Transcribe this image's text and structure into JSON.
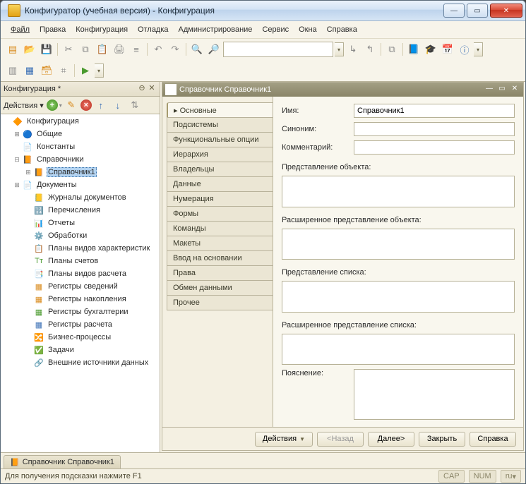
{
  "window": {
    "title": "Конфигуратор (учебная версия) - Конфигурация"
  },
  "menu": [
    "Файл",
    "Правка",
    "Конфигурация",
    "Отладка",
    "Администрирование",
    "Сервис",
    "Окна",
    "Справка"
  ],
  "side": {
    "title": "Конфигурация *",
    "actions_label": "Действия"
  },
  "tree": [
    {
      "d": 0,
      "tw": "",
      "ic": "🔶",
      "lbl": "Конфигурация"
    },
    {
      "d": 1,
      "tw": "⊞",
      "ic": "🔵",
      "lbl": "Общие"
    },
    {
      "d": 1,
      "tw": "",
      "ic": "📄",
      "lbl": "Константы"
    },
    {
      "d": 1,
      "tw": "⊟",
      "ic": "📙",
      "lbl": "Справочники"
    },
    {
      "d": 2,
      "tw": "⊞",
      "ic": "📙",
      "lbl": "Справочник1",
      "sel": true
    },
    {
      "d": 1,
      "tw": "⊞",
      "ic": "📄",
      "lbl": "Документы"
    },
    {
      "d": 2,
      "tw": "",
      "ic": "📒",
      "lbl": "Журналы документов"
    },
    {
      "d": 2,
      "tw": "",
      "ic": "🔢",
      "lbl": "Перечисления"
    },
    {
      "d": 2,
      "tw": "",
      "ic": "📊",
      "lbl": "Отчеты"
    },
    {
      "d": 2,
      "tw": "",
      "ic": "⚙️",
      "lbl": "Обработки"
    },
    {
      "d": 2,
      "tw": "",
      "ic": "📋",
      "lbl": "Планы видов характеристик"
    },
    {
      "d": 2,
      "tw": "",
      "ic": "Тт",
      "lbl": "Планы счетов",
      "cls": "c-green"
    },
    {
      "d": 2,
      "tw": "",
      "ic": "📑",
      "lbl": "Планы видов расчета"
    },
    {
      "d": 2,
      "tw": "",
      "ic": "▦",
      "lbl": "Регистры сведений",
      "cls": "c-orange"
    },
    {
      "d": 2,
      "tw": "",
      "ic": "▦",
      "lbl": "Регистры накопления",
      "cls": "c-orange"
    },
    {
      "d": 2,
      "tw": "",
      "ic": "▦",
      "lbl": "Регистры бухгалтерии",
      "cls": "c-green"
    },
    {
      "d": 2,
      "tw": "",
      "ic": "▦",
      "lbl": "Регистры расчета",
      "cls": "c-blue"
    },
    {
      "d": 2,
      "tw": "",
      "ic": "🔀",
      "lbl": "Бизнес-процессы"
    },
    {
      "d": 2,
      "tw": "",
      "ic": "✅",
      "lbl": "Задачи"
    },
    {
      "d": 2,
      "tw": "",
      "ic": "🔗",
      "lbl": "Внешние источники данных"
    }
  ],
  "editor": {
    "title": "Справочник Справочник1",
    "tabs": [
      "Основные",
      "Подсистемы",
      "Функциональные опции",
      "Иерархия",
      "Владельцы",
      "Данные",
      "Нумерация",
      "Формы",
      "Команды",
      "Макеты",
      "Ввод на основании",
      "Права",
      "Обмен данными",
      "Прочее"
    ],
    "active_tab": 0,
    "fields": {
      "name_label": "Имя:",
      "name_value": "Справочник1",
      "synonym_label": "Синоним:",
      "synonym_value": "",
      "comment_label": "Комментарий:",
      "comment_value": "",
      "obj_repr_label": "Представление объекта:",
      "obj_repr_value": "",
      "ext_obj_repr_label": "Расширенное представление объекта:",
      "ext_obj_repr_value": "",
      "list_repr_label": "Представление списка:",
      "list_repr_value": "",
      "ext_list_repr_label": "Расширенное представление списка:",
      "ext_list_repr_value": "",
      "explain_label": "Пояснение:",
      "explain_value": ""
    },
    "buttons": {
      "actions": "Действия",
      "back": "<Назад",
      "next": "Далее>",
      "close": "Закрыть",
      "help": "Справка"
    }
  },
  "doctab": "Справочник Справочник1",
  "status": {
    "hint": "Для получения подсказки нажмите F1",
    "cap": "CAP",
    "num": "NUM",
    "lang": "ru"
  }
}
